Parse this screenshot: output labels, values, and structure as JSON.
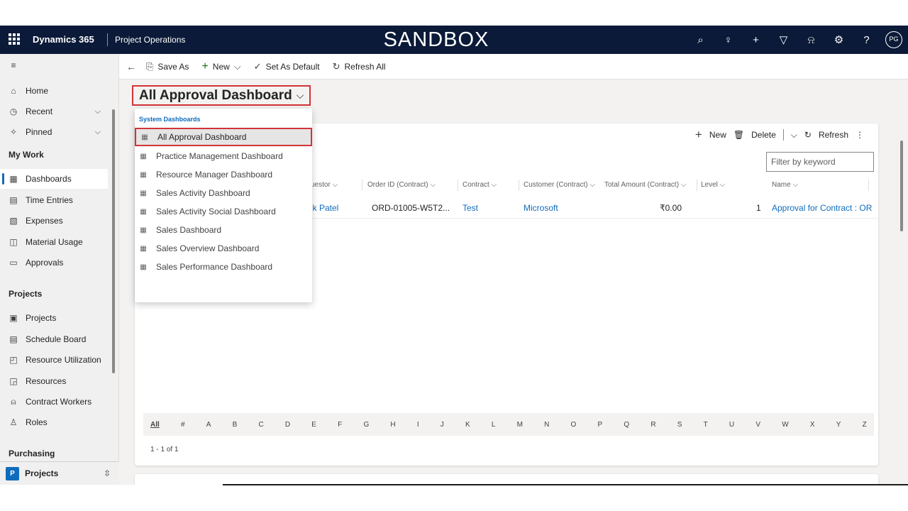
{
  "topbar": {
    "brand": "Dynamics 365",
    "app_name": "Project Operations",
    "environment": "SANDBOX",
    "icons": [
      "search-icon",
      "lightbulb-icon",
      "plus-icon",
      "filter-icon",
      "bell-icon",
      "gear-icon",
      "help-icon"
    ],
    "avatar_initials": "PG"
  },
  "commandbar": {
    "save_as": "Save As",
    "new": "New",
    "set_default": "Set As Default",
    "refresh_all": "Refresh All"
  },
  "nav": {
    "home": "Home",
    "recent": "Recent",
    "pinned": "Pinned",
    "group_my_work": "My Work",
    "my_work": [
      "Dashboards",
      "Time Entries",
      "Expenses",
      "Material Usage",
      "Approvals"
    ],
    "group_projects": "Projects",
    "projects": [
      "Projects",
      "Schedule Board",
      "Resource Utilization",
      "Resources",
      "Contract Workers",
      "Roles"
    ],
    "group_purchasing": "Purchasing",
    "area_badge": "P",
    "area_label": "Projects"
  },
  "dashboard": {
    "title": "All Approval Dashboard",
    "title_chevron": "⌵"
  },
  "dropdown": {
    "header": "System Dashboards",
    "items": [
      "All Approval Dashboard",
      "Practice Management Dashboard",
      "Resource Manager Dashboard",
      "Sales Activity Dashboard",
      "Sales Activity Social Dashboard",
      "Sales Dashboard",
      "Sales Overview Dashboard",
      "Sales Performance Dashboard"
    ],
    "selected_index": 0
  },
  "card": {
    "new": "New",
    "delete": "Delete",
    "refresh": "Refresh",
    "filter_placeholder": "Filter by keyword",
    "columns": [
      "uestor ⌵",
      "Order ID (Contract) ⌵",
      "Contract ⌵",
      "Customer (Contract) ⌵",
      "Total Amount (Contract) ⌵",
      "Level ⌵",
      "Name ⌵"
    ],
    "row": {
      "requestor": "ik Patel",
      "order_id": "ORD-01005-W5T2...",
      "contract": "Test",
      "customer": "Microsoft",
      "total_amount": "₹0.00",
      "level": "1",
      "name": "Approval for Contract : OR"
    },
    "alphabet": [
      "All",
      "#",
      "A",
      "B",
      "C",
      "D",
      "E",
      "F",
      "G",
      "H",
      "I",
      "J",
      "K",
      "L",
      "M",
      "N",
      "O",
      "P",
      "Q",
      "R",
      "S",
      "T",
      "U",
      "V",
      "W",
      "X",
      "Y",
      "Z"
    ],
    "paging": "1 - 1 of 1"
  }
}
